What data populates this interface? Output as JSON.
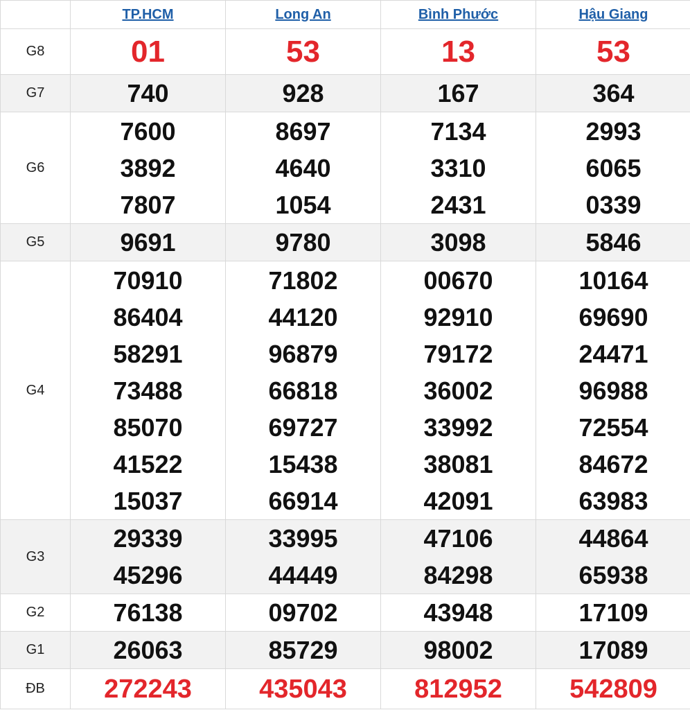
{
  "provinces": [
    "TP.HCM",
    "Long An",
    "Bình Phước",
    "Hậu Giang"
  ],
  "colors": {
    "link": "#1f5fa8",
    "highlight": "#e3262b",
    "shade": "#f2f2f2"
  },
  "prizes": [
    {
      "label": "G8",
      "values": [
        [
          "01"
        ],
        [
          "53"
        ],
        [
          "13"
        ],
        [
          "53"
        ]
      ]
    },
    {
      "label": "G7",
      "values": [
        [
          "740"
        ],
        [
          "928"
        ],
        [
          "167"
        ],
        [
          "364"
        ]
      ]
    },
    {
      "label": "G6",
      "values": [
        [
          "7600",
          "3892",
          "7807"
        ],
        [
          "8697",
          "4640",
          "1054"
        ],
        [
          "7134",
          "3310",
          "2431"
        ],
        [
          "2993",
          "6065",
          "0339"
        ]
      ]
    },
    {
      "label": "G5",
      "values": [
        [
          "9691"
        ],
        [
          "9780"
        ],
        [
          "3098"
        ],
        [
          "5846"
        ]
      ]
    },
    {
      "label": "G4",
      "values": [
        [
          "70910",
          "86404",
          "58291",
          "73488",
          "85070",
          "41522",
          "15037"
        ],
        [
          "71802",
          "44120",
          "96879",
          "66818",
          "69727",
          "15438",
          "66914"
        ],
        [
          "00670",
          "92910",
          "79172",
          "36002",
          "33992",
          "38081",
          "42091"
        ],
        [
          "10164",
          "69690",
          "24471",
          "96988",
          "72554",
          "84672",
          "63983"
        ]
      ]
    },
    {
      "label": "G3",
      "values": [
        [
          "29339",
          "45296"
        ],
        [
          "33995",
          "44449"
        ],
        [
          "47106",
          "84298"
        ],
        [
          "44864",
          "65938"
        ]
      ]
    },
    {
      "label": "G2",
      "values": [
        [
          "76138"
        ],
        [
          "09702"
        ],
        [
          "43948"
        ],
        [
          "17109"
        ]
      ]
    },
    {
      "label": "G1",
      "values": [
        [
          "26063"
        ],
        [
          "85729"
        ],
        [
          "98002"
        ],
        [
          "17089"
        ]
      ]
    },
    {
      "label": "ĐB",
      "values": [
        [
          "272243"
        ],
        [
          "435043"
        ],
        [
          "812952"
        ],
        [
          "542809"
        ]
      ]
    }
  ]
}
